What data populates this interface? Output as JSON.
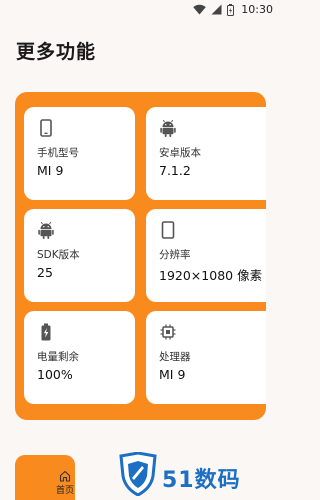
{
  "status": {
    "time": "10:30",
    "icons": [
      "wifi-icon",
      "cellular-icon",
      "battery-icon"
    ]
  },
  "page": {
    "title": "更多功能"
  },
  "colors": {
    "accent": "#f98b1e",
    "card_bg": "#ffffff",
    "page_bg": "#faf7f5",
    "watermark": "#1d6fc4"
  },
  "cards": [
    {
      "icon": "phone-icon",
      "label": "手机型号",
      "value": "MI 9"
    },
    {
      "icon": "android-icon",
      "label": "安卓版本",
      "value": "7.1.2"
    },
    {
      "icon": "android-icon",
      "label": "SDK版本",
      "value": "25"
    },
    {
      "icon": "screen-icon",
      "label": "分辨率",
      "value": "1920×1080 像素"
    },
    {
      "icon": "battery-charging-icon",
      "label": "电量剩余",
      "value": "100%"
    },
    {
      "icon": "cpu-icon",
      "label": "处理器",
      "value": "MI 9"
    }
  ],
  "tab_bar": {
    "home_label": "首页"
  },
  "watermark": {
    "text": "51数码"
  }
}
